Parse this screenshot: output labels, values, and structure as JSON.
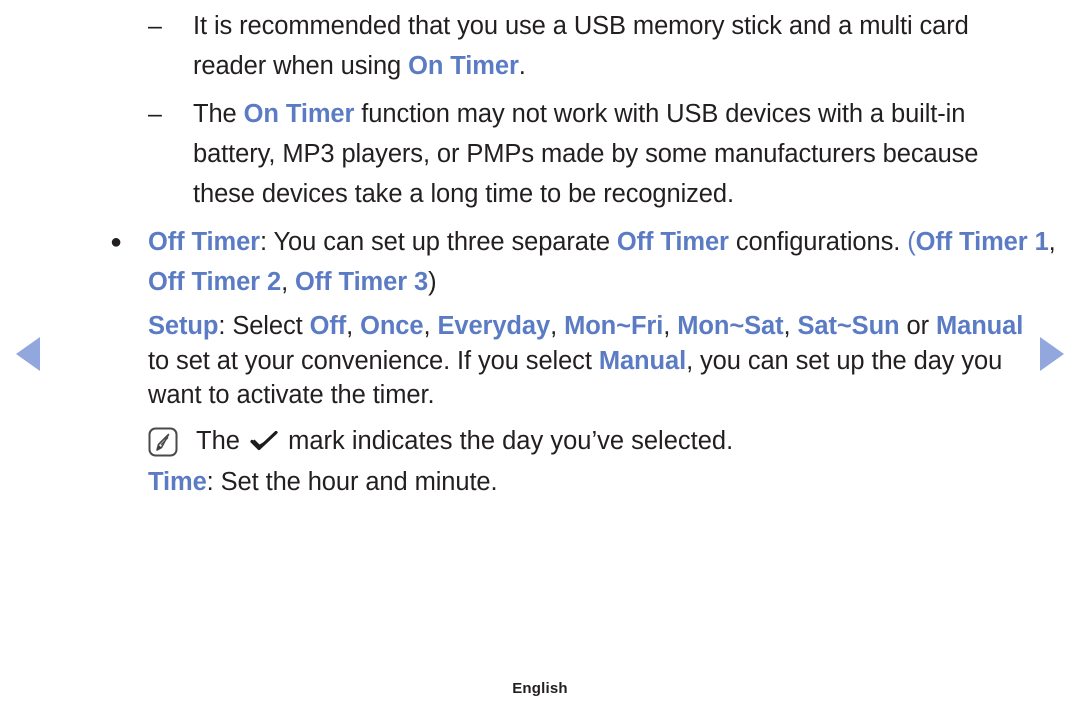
{
  "page": {
    "language_footer": "English",
    "accent_color": "#5b7cc4",
    "text_color": "#231f20",
    "arrow_color": "#92a7de",
    "background": "#ffffff"
  },
  "nav": {
    "prev_label": "previous page",
    "next_label": "next page"
  },
  "markers": {
    "dash": "–",
    "bullet": "●"
  },
  "notes": [
    {
      "id": "usb-recommendation",
      "marker": "–",
      "segments": [
        {
          "text": "It is recommended that you use a USB memory stick and a multi card reader when using ",
          "style": "plain"
        },
        {
          "text": "On Timer",
          "style": "blue"
        },
        {
          "text": ".",
          "style": "plain"
        }
      ]
    },
    {
      "id": "on-timer-limitations",
      "marker": "–",
      "segments": [
        {
          "text": "The ",
          "style": "plain"
        },
        {
          "text": "On Timer",
          "style": "blue"
        },
        {
          "text": " function may not work with USB devices with a built-in battery, MP3 players, or PMPs made by some manufacturers because these devices take a long time to be recognized.",
          "style": "plain"
        }
      ]
    }
  ],
  "off_timer_item": {
    "marker": "●",
    "segments": [
      {
        "text": "Off Timer",
        "style": "blue"
      },
      {
        "text": ": You can set up three separate ",
        "style": "plain"
      },
      {
        "text": "Off Timer",
        "style": "blue"
      },
      {
        "text": " configurations. (",
        "style": "plain"
      },
      {
        "text": "Off Timer 1",
        "style": "blue"
      },
      {
        "text": ", ",
        "style": "plain"
      },
      {
        "text": "Off Timer 2",
        "style": "blue"
      },
      {
        "text": ", ",
        "style": "plain"
      },
      {
        "text": "Off Timer 3",
        "style": "blue"
      },
      {
        "text": ")",
        "style": "plain"
      }
    ],
    "open_paren_blue": "("
  },
  "setup": {
    "segments": [
      {
        "text": "Setup",
        "style": "blue"
      },
      {
        "text": ": Select ",
        "style": "plain"
      },
      {
        "text": "Off",
        "style": "blue"
      },
      {
        "text": ", ",
        "style": "plain"
      },
      {
        "text": "Once",
        "style": "blue"
      },
      {
        "text": ", ",
        "style": "plain"
      },
      {
        "text": "Everyday",
        "style": "blue"
      },
      {
        "text": ", ",
        "style": "plain"
      },
      {
        "text": "Mon~Fri",
        "style": "blue"
      },
      {
        "text": ", ",
        "style": "plain"
      },
      {
        "text": "Mon~Sat",
        "style": "blue"
      },
      {
        "text": ", ",
        "style": "plain"
      },
      {
        "text": "Sat~Sun",
        "style": "blue"
      },
      {
        "text": " or ",
        "style": "plain"
      },
      {
        "text": "Manual",
        "style": "blue"
      },
      {
        "text": " to set at your convenience. If you select ",
        "style": "plain"
      },
      {
        "text": "Manual",
        "style": "blue"
      },
      {
        "text": ", you can set up the day you want to activate the timer.",
        "style": "plain"
      }
    ],
    "options": [
      "Off",
      "Once",
      "Everyday",
      "Mon~Fri",
      "Mon~Sat",
      "Sat~Sun",
      "Manual"
    ],
    "label": "Setup"
  },
  "note_mark": {
    "icon_name": "note-pen-icon",
    "prefix": "The ",
    "suffix": " mark indicates the day you’ve selected.",
    "check_icon_name": "checkmark-icon"
  },
  "time": {
    "segments": [
      {
        "text": "Time",
        "style": "blue"
      },
      {
        "text": ": Set the hour and minute.",
        "style": "plain"
      }
    ],
    "label": "Time"
  }
}
